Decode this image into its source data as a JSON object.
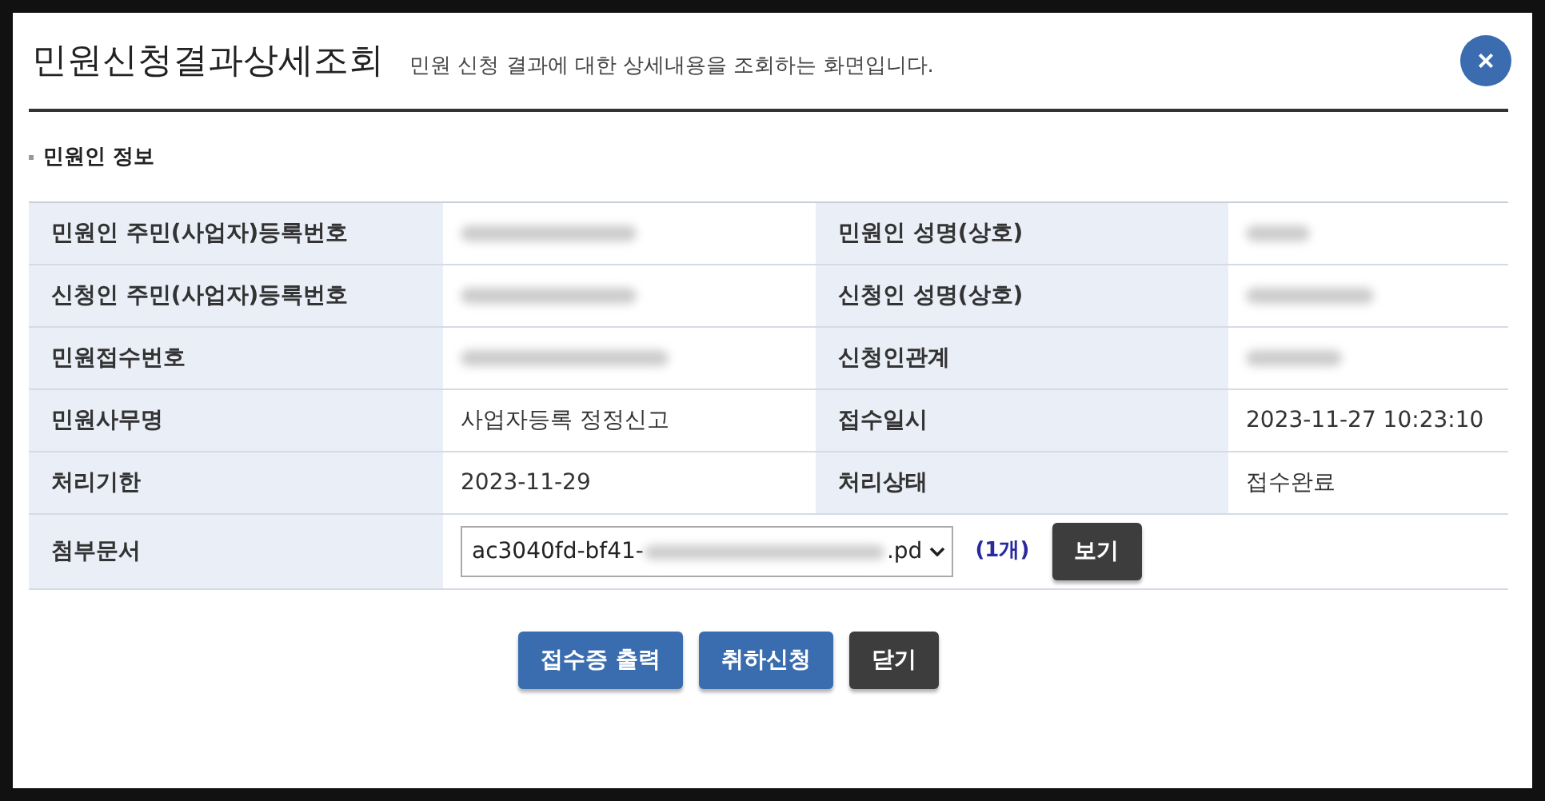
{
  "dialog": {
    "title": "민원신청결과상세조회",
    "subtitle": "민원 신청 결과에 대한 상세내용을 조회하는 화면입니다.",
    "close_icon": "×"
  },
  "section": {
    "title": "민원인 정보"
  },
  "rows": [
    {
      "cells": [
        {
          "label": "민원인 주민(사업자)등록번호",
          "redacted": true
        },
        {
          "label": "민원인 성명(상호)",
          "redacted": true
        }
      ]
    },
    {
      "cells": [
        {
          "label": "신청인 주민(사업자)등록번호",
          "redacted": true
        },
        {
          "label": "신청인 성명(상호)",
          "redacted": true
        }
      ]
    },
    {
      "cells": [
        {
          "label": "민원접수번호",
          "redacted": true
        },
        {
          "label": "신청인관계",
          "redacted": true
        }
      ]
    },
    {
      "cells": [
        {
          "label": "민원사무명",
          "value": "사업자등록 정정신고",
          "redacted": false
        },
        {
          "label": "접수일시",
          "value": "2023-11-27 10:23:10",
          "redacted": false
        }
      ]
    },
    {
      "cells": [
        {
          "label": "처리기한",
          "value": "2023-11-29",
          "redacted": false
        },
        {
          "label": "처리상태",
          "value": "접수완료",
          "redacted": false
        }
      ]
    }
  ],
  "attachment": {
    "label": "첨부문서",
    "file_prefix": "ac3040fd-bf41-",
    "file_suffix": ".pd",
    "count": "(1개)",
    "view_button": "보기"
  },
  "buttons": [
    {
      "label": "접수증 출력",
      "kind": "primary"
    },
    {
      "label": "취하신청",
      "kind": "primary"
    },
    {
      "label": "닫기",
      "kind": "dark"
    }
  ]
}
